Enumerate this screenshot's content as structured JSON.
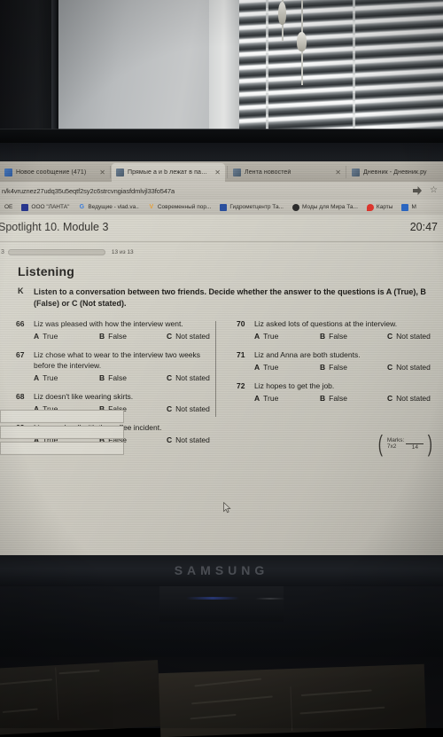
{
  "browser": {
    "tabs": [
      {
        "title": "Новое сообщение (471)",
        "favicon": "mail-icon",
        "active": false,
        "closable": true
      },
      {
        "title": "Прямые a и b лежат в паралле",
        "favicon": "vk-icon",
        "active": true,
        "closable": true
      },
      {
        "title": "Лента новостей",
        "favicon": "vk-icon",
        "active": false,
        "closable": true
      },
      {
        "title": "Дневник - Дневник.ру",
        "favicon": "vk-icon",
        "active": false,
        "closable": false
      }
    ],
    "close_glyph": "✕",
    "url": "n/k4vruznez27udq35u5eqtf2sy2c6strcvngiasfdmlvjl33fo547a",
    "url_icons": [
      "extension-icon",
      "bookmark-star-icon"
    ],
    "star_glyph": "☆",
    "bookmarks": [
      {
        "label": "ОЕ",
        "icon_color": "#3a3833",
        "letter": ""
      },
      {
        "label": "ООО \"ЛАНТА\"",
        "icon_color": "#26348f",
        "letter": ""
      },
      {
        "label": "Ведущие - vlad.va..",
        "icon_color": "#ffffff",
        "letter": "G"
      },
      {
        "label": "Современный пор...",
        "icon_color": "#e8a33d",
        "letter": "V"
      },
      {
        "label": "Гидрометцентр Та...",
        "icon_color": "#2a4fa0",
        "letter": ""
      },
      {
        "label": "Моды для Мира Та...",
        "icon_color": "#2b2b2b",
        "letter": ""
      },
      {
        "label": "Карты",
        "icon_color": "#e0342c",
        "letter": ""
      },
      {
        "label": "М",
        "icon_color": "#2a66c4",
        "letter": ""
      }
    ]
  },
  "page": {
    "title": "Spotlight 10. Module 3",
    "clock": "20:47",
    "progress": {
      "prefix": "3",
      "label": "13 из 13",
      "percent": 100,
      "fill_color": "#2d6029"
    },
    "section_heading": "Listening",
    "task": {
      "letter": "K",
      "text": "Listen to a conversation between two friends. Decide whether the answer to the questions is A (True), B (False) or C (Not stated)."
    },
    "options": [
      {
        "letter": "A",
        "label": "True"
      },
      {
        "letter": "B",
        "label": "False"
      },
      {
        "letter": "C",
        "label": "Not stated"
      }
    ],
    "questions_left": [
      {
        "num": "66",
        "text": "Liz was pleased with how the interview went."
      },
      {
        "num": "67",
        "text": "Liz chose what to wear to the interview two weeks before the interview."
      },
      {
        "num": "68",
        "text": "Liz doesn't like wearing skirts."
      },
      {
        "num": "69",
        "text": "Liz coped well with the coffee incident."
      }
    ],
    "questions_right": [
      {
        "num": "70",
        "text": "Liz asked lots of questions at the interview."
      },
      {
        "num": "71",
        "text": "Liz and Anna are both students."
      },
      {
        "num": "72",
        "text": "Liz hopes to get the job."
      }
    ],
    "marks": {
      "label": "Marks:",
      "formula": "7x2",
      "total": "14"
    },
    "answer_boxes": 3
  },
  "hardware": {
    "monitor_brand": "SAMSUNG"
  }
}
